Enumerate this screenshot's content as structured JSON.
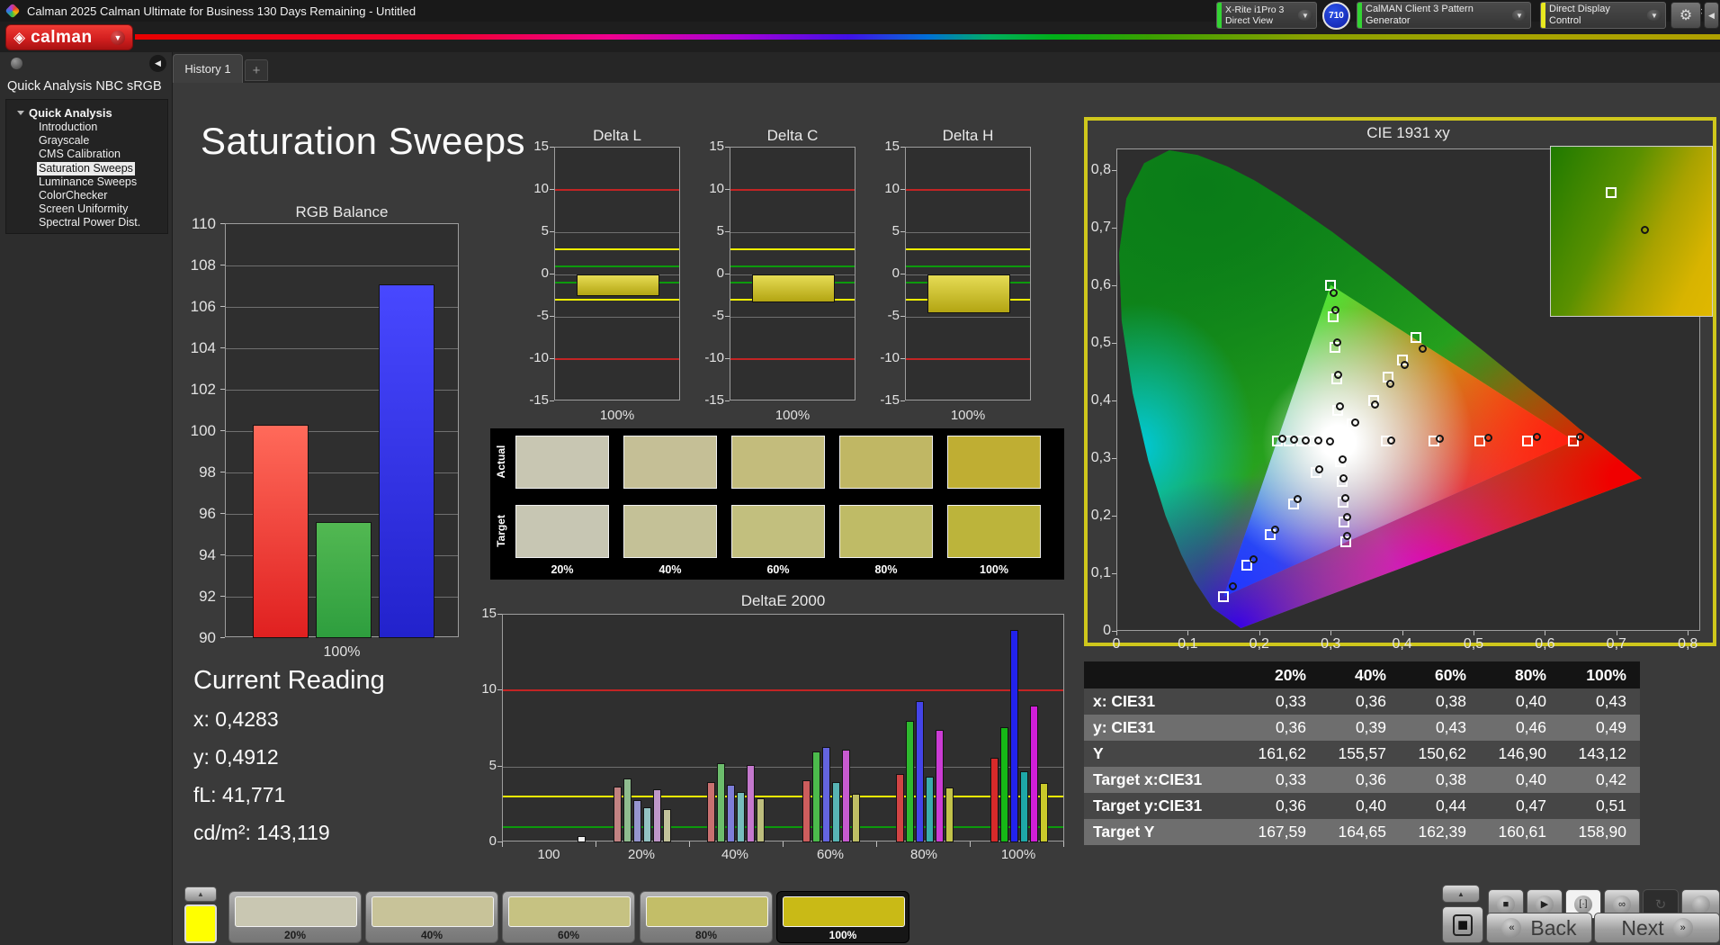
{
  "window": {
    "title": "Calman 2025 Calman Ultimate for Business 130 Days Remaining  - Untitled"
  },
  "brand": {
    "logo_text": "calman"
  },
  "tabs": {
    "history": "History 1",
    "add": "+"
  },
  "meters": {
    "probe_line1": "X-Rite i1Pro 3",
    "probe_line2": "Direct View",
    "badge": "710",
    "pattern_generator": "CalMAN Client 3 Pattern Generator",
    "display_control": "Direct Display Control"
  },
  "sidebar": {
    "workflow_title": "Quick Analysis NBC sRGB",
    "root": "Quick Analysis",
    "items": [
      "Introduction",
      "Grayscale",
      "CMS Calibration",
      "Saturation Sweeps",
      "Luminance Sweeps",
      "ColorChecker",
      "Screen Uniformity",
      "Spectral Power Dist."
    ],
    "selected_index": 3
  },
  "page_title": "Saturation Sweeps",
  "current_reading": {
    "title": "Current Reading",
    "lines": [
      "x: 0,4283",
      "y: 0,4912",
      "fL: 41,771",
      "cd/m²: 143,119"
    ]
  },
  "chart_data": [
    {
      "id": "rgb_balance",
      "type": "bar",
      "title": "RGB Balance",
      "xlabel": "100%",
      "categories": [
        "Red",
        "Green",
        "Blue"
      ],
      "values": [
        100.3,
        95.6,
        107.1
      ],
      "colors": [
        "#e83030",
        "#36a446",
        "#3030e8"
      ],
      "ylim": [
        90,
        110
      ],
      "ytick_step": 2
    },
    {
      "id": "delta_l",
      "type": "bar",
      "title": "Delta L",
      "xlabel": "100%",
      "categories": [
        "100%"
      ],
      "values": [
        -2.6
      ],
      "ylim": [
        -15,
        15
      ],
      "limit_lines": {
        "red": [
          10,
          -10
        ],
        "yellow": [
          3,
          -3
        ],
        "green": [
          1,
          -1
        ]
      }
    },
    {
      "id": "delta_c",
      "type": "bar",
      "title": "Delta C",
      "xlabel": "100%",
      "categories": [
        "100%"
      ],
      "values": [
        -3.3
      ],
      "ylim": [
        -15,
        15
      ],
      "limit_lines": {
        "red": [
          10,
          -10
        ],
        "yellow": [
          3,
          -3
        ],
        "green": [
          1,
          -1
        ]
      }
    },
    {
      "id": "delta_h",
      "type": "bar",
      "title": "Delta H",
      "xlabel": "100%",
      "categories": [
        "100%"
      ],
      "values": [
        -4.6
      ],
      "ylim": [
        -15,
        15
      ],
      "limit_lines": {
        "red": [
          10,
          -10
        ],
        "yellow": [
          3,
          -3
        ],
        "green": [
          1,
          -1
        ]
      }
    },
    {
      "id": "deltae2000",
      "type": "bar",
      "title": "DeltaE 2000",
      "ylim": [
        0,
        15
      ],
      "limit_lines": {
        "red": [
          10
        ],
        "yellow": [
          3
        ],
        "green": [
          1
        ]
      },
      "series_note": "six sweep colors R G B C M Y per saturation group",
      "groups": [
        {
          "label": "100",
          "values": [
            0.4
          ],
          "colors": [
            "#f0f0f0"
          ]
        },
        {
          "label": "20%",
          "values": [
            3.7,
            4.2,
            2.8,
            2.3,
            3.5,
            2.2
          ],
          "colors": [
            "#c28282",
            "#8fbc8f",
            "#9595cf",
            "#93c2c2",
            "#bf97c9",
            "#c3c39b"
          ]
        },
        {
          "label": "40%",
          "values": [
            4.0,
            5.2,
            3.8,
            3.3,
            5.1,
            2.9
          ],
          "colors": [
            "#c97070",
            "#6cbd6c",
            "#7d7dd8",
            "#76bcbc",
            "#c478cd",
            "#bdbd7d"
          ]
        },
        {
          "label": "60%",
          "values": [
            4.1,
            6.0,
            6.3,
            4.0,
            6.1,
            3.2
          ],
          "colors": [
            "#cd5d5d",
            "#4cbb4c",
            "#6464e0",
            "#58b4b4",
            "#c75ad0",
            "#bebe64"
          ]
        },
        {
          "label": "80%",
          "values": [
            4.5,
            8.0,
            9.3,
            4.3,
            7.4,
            3.6
          ],
          "colors": [
            "#d14444",
            "#2eb92e",
            "#4444e8",
            "#3aacac",
            "#cb3cd4",
            "#c2c24a"
          ]
        },
        {
          "label": "100%",
          "values": [
            5.6,
            7.6,
            14.0,
            4.7,
            9.0,
            3.9
          ],
          "colors": [
            "#d62a2a",
            "#16b816",
            "#2222ec",
            "#1ea8a8",
            "#d01ed8",
            "#c9c92a"
          ]
        }
      ]
    },
    {
      "id": "cie1931",
      "type": "scatter",
      "title": "CIE 1931 xy",
      "xlim": [
        0,
        0.8
      ],
      "ylim": [
        0,
        0.8375
      ],
      "xticks": [
        "0",
        "0,1",
        "0,2",
        "0,3",
        "0,4",
        "0,5",
        "0,6",
        "0,7",
        "0,8"
      ],
      "yticks": [
        "0",
        "0,1",
        "0,2",
        "0,3",
        "0,4",
        "0,5",
        "0,6",
        "0,7",
        "0,8"
      ],
      "targets": [
        [
          0.33,
          0.36
        ],
        [
          0.36,
          0.4
        ],
        [
          0.38,
          0.44
        ],
        [
          0.4,
          0.47
        ],
        [
          0.42,
          0.51
        ],
        [
          0.378,
          0.329
        ],
        [
          0.444,
          0.329
        ],
        [
          0.509,
          0.33
        ],
        [
          0.575,
          0.33
        ],
        [
          0.64,
          0.33
        ],
        [
          0.31,
          0.383
        ],
        [
          0.308,
          0.437
        ],
        [
          0.306,
          0.492
        ],
        [
          0.303,
          0.546
        ],
        [
          0.3,
          0.6
        ],
        [
          0.28,
          0.275
        ],
        [
          0.248,
          0.221
        ],
        [
          0.215,
          0.167
        ],
        [
          0.183,
          0.114
        ],
        [
          0.15,
          0.06
        ],
        [
          0.295,
          0.329
        ],
        [
          0.277,
          0.329
        ],
        [
          0.26,
          0.329
        ],
        [
          0.242,
          0.329
        ],
        [
          0.225,
          0.329
        ],
        [
          0.314,
          0.294
        ],
        [
          0.316,
          0.259
        ],
        [
          0.318,
          0.224
        ],
        [
          0.319,
          0.189
        ],
        [
          0.321,
          0.154
        ]
      ],
      "measured": [
        [
          0.334,
          0.363
        ],
        [
          0.362,
          0.394
        ],
        [
          0.383,
          0.429
        ],
        [
          0.403,
          0.462
        ],
        [
          0.428,
          0.491
        ],
        [
          0.384,
          0.332
        ],
        [
          0.452,
          0.334
        ],
        [
          0.52,
          0.336
        ],
        [
          0.588,
          0.337
        ],
        [
          0.648,
          0.338
        ],
        [
          0.312,
          0.39
        ],
        [
          0.31,
          0.446
        ],
        [
          0.308,
          0.502
        ],
        [
          0.306,
          0.558
        ],
        [
          0.303,
          0.588
        ],
        [
          0.284,
          0.281
        ],
        [
          0.253,
          0.229
        ],
        [
          0.222,
          0.177
        ],
        [
          0.191,
          0.125
        ],
        [
          0.162,
          0.078
        ],
        [
          0.299,
          0.33
        ],
        [
          0.282,
          0.331
        ],
        [
          0.265,
          0.332
        ],
        [
          0.248,
          0.333
        ],
        [
          0.232,
          0.334
        ],
        [
          0.316,
          0.299
        ],
        [
          0.318,
          0.265
        ],
        [
          0.32,
          0.232
        ],
        [
          0.322,
          0.198
        ],
        [
          0.323,
          0.165
        ]
      ]
    }
  ],
  "swatch_compare": {
    "row_labels": [
      "Actual",
      "Target"
    ],
    "col_labels": [
      "20%",
      "40%",
      "60%",
      "80%",
      "100%"
    ],
    "actual": [
      "#c8c6b2",
      "#c5bf96",
      "#c3bc7c",
      "#c0b764",
      "#bfae33"
    ],
    "target": [
      "#c7c6b3",
      "#c4c197",
      "#c2bf7e",
      "#bfbb66",
      "#bcb43b"
    ]
  },
  "results_table": {
    "headers": [
      "",
      "20%",
      "40%",
      "60%",
      "80%",
      "100%"
    ],
    "rows": [
      {
        "label": "x: CIE31",
        "values": [
          "0,33",
          "0,36",
          "0,38",
          "0,40",
          "0,43"
        ]
      },
      {
        "label": "y: CIE31",
        "values": [
          "0,36",
          "0,39",
          "0,43",
          "0,46",
          "0,49"
        ]
      },
      {
        "label": "Y",
        "values": [
          "161,62",
          "155,57",
          "150,62",
          "146,90",
          "143,12"
        ]
      },
      {
        "label": "Target x:CIE31",
        "values": [
          "0,33",
          "0,36",
          "0,38",
          "0,40",
          "0,42"
        ]
      },
      {
        "label": "Target y:CIE31",
        "values": [
          "0,36",
          "0,40",
          "0,44",
          "0,47",
          "0,51"
        ]
      },
      {
        "label": "Target Y",
        "values": [
          "167,59",
          "164,65",
          "162,39",
          "160,61",
          "158,90"
        ]
      }
    ]
  },
  "pattern_bar": {
    "quick_color": "#ffff00",
    "levels": [
      {
        "label": "20%",
        "color": "#c9c7b2",
        "selected": false
      },
      {
        "label": "40%",
        "color": "#c8c399",
        "selected": false
      },
      {
        "label": "60%",
        "color": "#c6c282",
        "selected": false
      },
      {
        "label": "80%",
        "color": "#c3be68",
        "selected": false
      },
      {
        "label": "100%",
        "color": "#c9ba16",
        "selected": true
      }
    ]
  },
  "transport": {
    "back": "Back",
    "next": "Next"
  }
}
